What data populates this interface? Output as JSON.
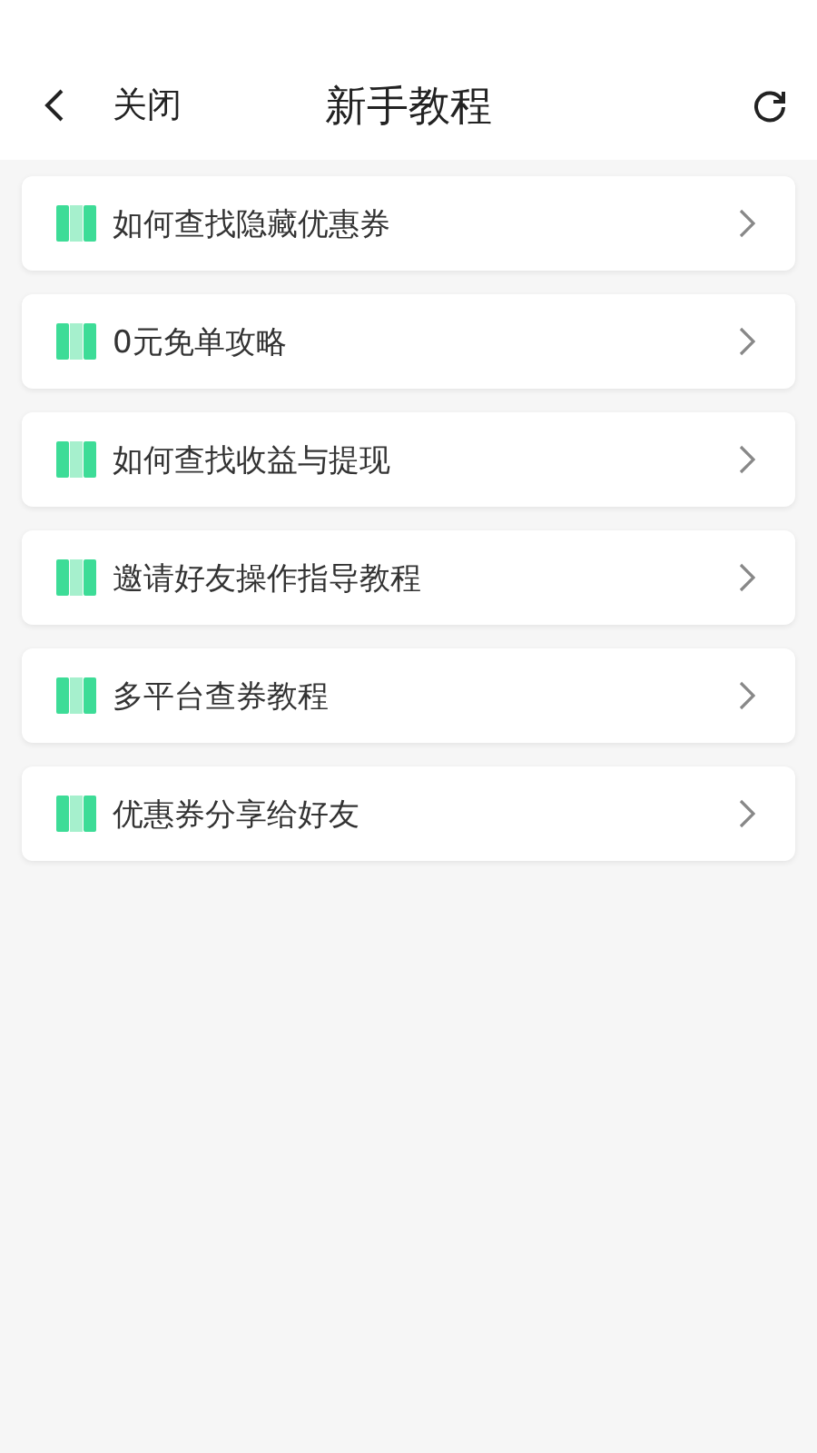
{
  "header": {
    "close_label": "关闭",
    "title": "新手教程"
  },
  "items": [
    {
      "label": "如何查找隐藏优惠券"
    },
    {
      "label": "0元免单攻略"
    },
    {
      "label": "如何查找收益与提现"
    },
    {
      "label": "邀请好友操作指导教程"
    },
    {
      "label": "多平台查券教程"
    },
    {
      "label": "优惠券分享给好友"
    }
  ]
}
